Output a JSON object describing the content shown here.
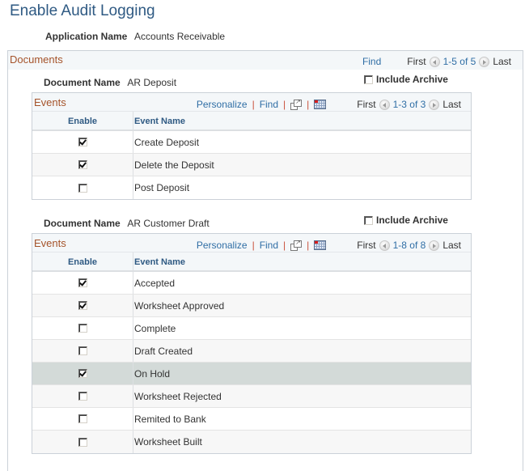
{
  "page": {
    "title": "Enable Audit Logging"
  },
  "application": {
    "label": "Application Name",
    "value": "Accounts Receivable"
  },
  "documents_grid": {
    "title": "Documents",
    "find": "Find",
    "first": "First",
    "range": "1-5 of 5",
    "last": "Last"
  },
  "documents": [
    {
      "name_label": "Document Name",
      "name": "AR Deposit",
      "include_archive_label": "Include Archive",
      "include_archive": false,
      "events": {
        "title": "Events",
        "personalize": "Personalize",
        "find": "Find",
        "first": "First",
        "range": "1-3 of 3",
        "last": "Last",
        "columns": {
          "enable": "Enable",
          "event_name": "Event Name"
        },
        "rows": [
          {
            "enabled": true,
            "name": "Create Deposit"
          },
          {
            "enabled": true,
            "name": "Delete the Deposit"
          },
          {
            "enabled": false,
            "name": "Post Deposit"
          }
        ]
      }
    },
    {
      "name_label": "Document Name",
      "name": "AR Customer Draft",
      "include_archive_label": "Include Archive",
      "include_archive": false,
      "events": {
        "title": "Events",
        "personalize": "Personalize",
        "find": "Find",
        "first": "First",
        "range": "1-8 of 8",
        "last": "Last",
        "columns": {
          "enable": "Enable",
          "event_name": "Event Name"
        },
        "rows": [
          {
            "enabled": true,
            "name": "Accepted"
          },
          {
            "enabled": true,
            "name": "Worksheet Approved"
          },
          {
            "enabled": false,
            "name": "Complete"
          },
          {
            "enabled": false,
            "name": "Draft Created"
          },
          {
            "enabled": true,
            "name": "On Hold",
            "highlighted": true
          },
          {
            "enabled": false,
            "name": "Worksheet Rejected"
          },
          {
            "enabled": false,
            "name": "Remited to Bank"
          },
          {
            "enabled": false,
            "name": "Worksheet Built"
          }
        ]
      }
    }
  ],
  "icons": {
    "prev": "arrow-left-circle",
    "next": "arrow-right-circle",
    "zoom": "view-all-zoom",
    "download": "download-to-spreadsheet"
  }
}
